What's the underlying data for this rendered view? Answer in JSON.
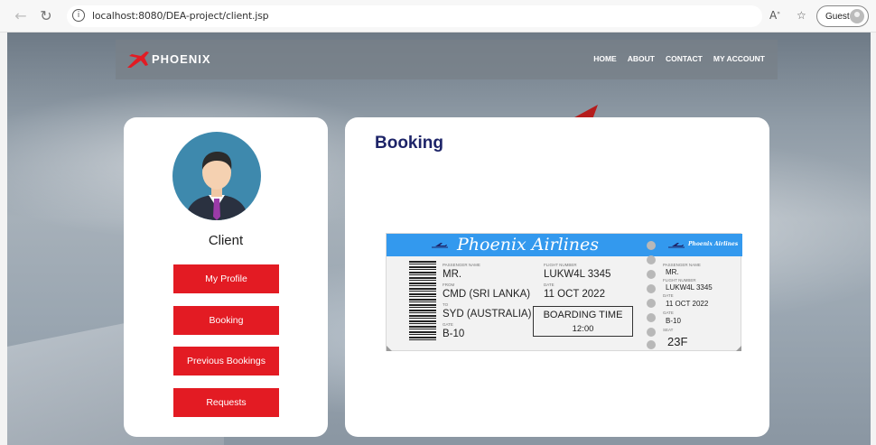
{
  "browser": {
    "url": "localhost:8080/DEA-project/client.jsp",
    "profile_label": "Guest",
    "icons": {
      "back": "back-arrow-icon",
      "reload": "reload-icon",
      "info": "info-icon",
      "read_aloud": "read-aloud-icon",
      "favorites": "favorites-icon"
    }
  },
  "site": {
    "logo_text": "PHOENIX",
    "nav": [
      "HOME",
      "ABOUT",
      "CONTACT",
      "MY ACCOUNT"
    ],
    "brand_color": "#e31b23"
  },
  "client_panel": {
    "title": "Client",
    "buttons": [
      "My Profile",
      "Booking",
      "Previous Bookings",
      "Requests"
    ]
  },
  "booking_panel": {
    "title": "Booking",
    "ticket": {
      "airline": "Phoenix Airlines",
      "passenger_label": "PASSENGER NAME",
      "passenger": "MR.",
      "flight_label": "FLIGHT NUMBER",
      "flight": "LUKW4L 3345",
      "from_label": "FROM",
      "from": "CMD (SRI LANKA)",
      "date_label": "DATE",
      "date": "11 OCT 2022",
      "to_label": "TO",
      "to": "SYD (AUSTRALIA)",
      "gate_label": "GATE",
      "gate": "B-10",
      "boarding_label": "BOARDING TIME",
      "boarding_time": "12:00",
      "seat_label": "SEAT",
      "seat": "23F"
    }
  }
}
